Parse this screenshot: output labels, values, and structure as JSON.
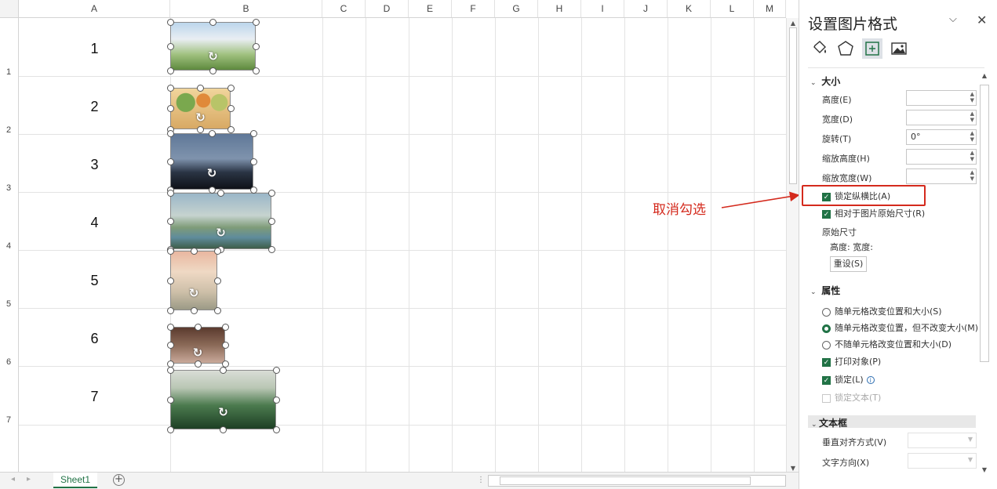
{
  "columns": [
    "A",
    "B",
    "C",
    "D",
    "E",
    "F",
    "G",
    "H",
    "I",
    "J",
    "K",
    "L",
    "M"
  ],
  "rows": [
    "1",
    "2",
    "3",
    "4",
    "5",
    "6",
    "7"
  ],
  "cells": [
    "1",
    "2",
    "3",
    "4",
    "5",
    "6",
    "7"
  ],
  "sheet_tab": "Sheet1",
  "add_sheet": "+",
  "annotation": "取消勾选",
  "pane": {
    "title": "设置图片格式",
    "collapse": "⌵",
    "close": "✕",
    "section_size": "大小",
    "height_label": "高度(E)",
    "width_label": "宽度(D)",
    "rotate_label": "旋转(T)",
    "rotate_value": "0°",
    "scale_h_label": "缩放高度(H)",
    "scale_w_label": "缩放宽度(W)",
    "lock_ratio": "锁定纵横比(A)",
    "relative_original": "相对于图片原始尺寸(R)",
    "original_size": "原始尺寸",
    "orig_dims": "高度:   宽度:",
    "reset": "重设(S)",
    "section_props": "属性",
    "prop1": "随单元格改变位置和大小(S)",
    "prop2": "随单元格改变位置，但不改变大小(M)",
    "prop3": "不随单元格改变位置和大小(D)",
    "print_obj": "打印对象(P)",
    "locked": "锁定(L)",
    "lock_text": "锁定文本(T)",
    "section_textbox": "文本框",
    "valign": "垂直对齐方式(V)",
    "text_dir": "文字方向(X)"
  }
}
